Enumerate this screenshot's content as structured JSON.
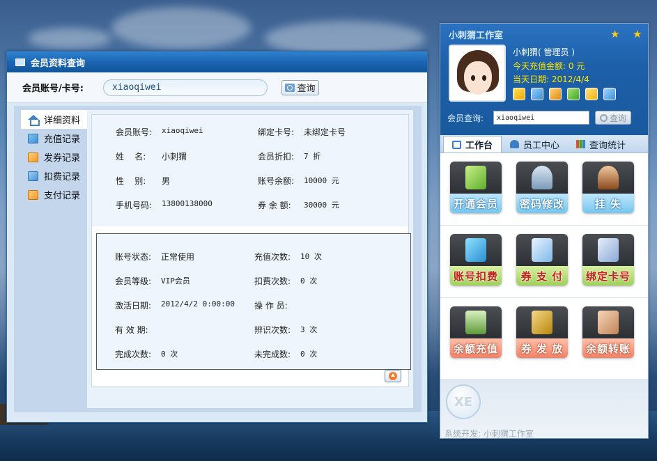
{
  "left_window": {
    "title": "会员资料查询",
    "search_label": "会员账号/卡号:",
    "search_value": "xiaoqiwei",
    "query_button": "查询",
    "nav": [
      {
        "label": "详细资料",
        "icon": "home-icon"
      },
      {
        "label": "充值记录",
        "icon": "recharge-record-icon"
      },
      {
        "label": "发券记录",
        "icon": "coupon-record-icon"
      },
      {
        "label": "扣费记录",
        "icon": "deduct-record-icon"
      },
      {
        "label": "支付记录",
        "icon": "payment-record-icon"
      }
    ],
    "basic": {
      "account_k": "会员账号:",
      "account_v": "xiaoqiwei",
      "card_k": "绑定卡号:",
      "card_v": "未绑定卡号",
      "name_k": "姓    名:",
      "name_v": "小刺猬",
      "discount_k": "会员折扣:",
      "discount_v": "7 折",
      "gender_k": "性    别:",
      "gender_v": "男",
      "balance_k": "账号余额:",
      "balance_v": "10000 元",
      "phone_k": "手机号码:",
      "phone_v": "13800138000",
      "coupon_k": "券 余 额:",
      "coupon_v": "30000 元"
    },
    "status": {
      "state_k": "账号状态:",
      "state_v": "正常使用",
      "recharge_count_k": "充值次数:",
      "recharge_count_v": "10 次",
      "level_k": "会员等级:",
      "level_v": "VIP会员",
      "deduct_count_k": "扣费次数:",
      "deduct_count_v": "0 次",
      "activate_k": "激活日期:",
      "activate_v": "2012/4/2 0:00:00",
      "operator_k": "操 作 员:",
      "operator_v": "",
      "valid_k": "有 效 期:",
      "valid_v": "",
      "identify_k": "辨识次数:",
      "identify_v": "3 次",
      "done_k": "完成次数:",
      "done_v": "0 次",
      "undone_k": "未完成数:",
      "undone_v": "0 次"
    }
  },
  "right_window": {
    "title": "小刺猬工作室",
    "user_name": "小刺猬( 管理员 )",
    "today_recharge": "今天充值金额: 0 元",
    "today_date": "当天日期: 2012/4/4",
    "member_query_label": "会员查询:",
    "member_query_value": "xiaoqiwei",
    "query_button": "查询",
    "tabs": [
      {
        "label": "工作台",
        "icon": "home-icon"
      },
      {
        "label": "员工中心",
        "icon": "user-icon"
      },
      {
        "label": "查询统计",
        "icon": "bar-chart-icon"
      }
    ],
    "tiles": [
      {
        "label": "开通会员",
        "icon": "open-member-icon"
      },
      {
        "label": "密码修改",
        "icon": "lock-icon"
      },
      {
        "label": "挂 失",
        "icon": "report-loss-icon"
      },
      {
        "label": "账号扣费",
        "icon": "yen-icon"
      },
      {
        "label": "券 支 付",
        "icon": "coupon-pay-icon"
      },
      {
        "label": "绑定卡号",
        "icon": "bind-card-icon"
      },
      {
        "label": "余额充值",
        "icon": "money-stack-icon"
      },
      {
        "label": "券 发 放",
        "icon": "folder-icon"
      },
      {
        "label": "余额转账",
        "icon": "handshake-icon"
      }
    ],
    "logo_text": "XE",
    "credit": "系统开发: 小刺猬工作室"
  }
}
